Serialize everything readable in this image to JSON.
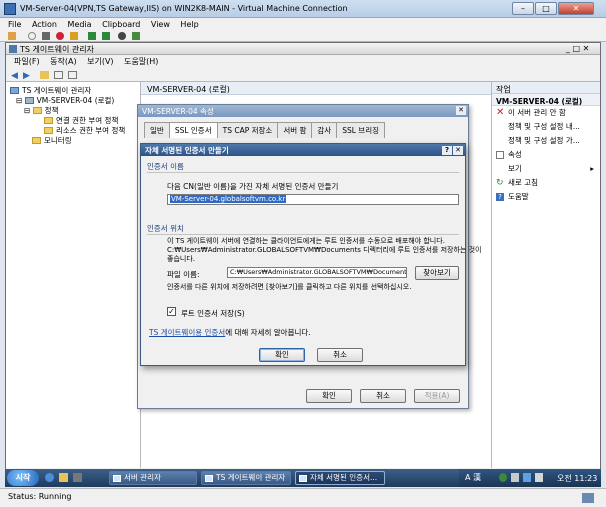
{
  "vm_window": {
    "title": "VM-Server-04(VPN,TS Gateway,IIS) on WIN2K8-MAIN - Virtual Machine Connection",
    "menu": [
      "File",
      "Action",
      "Media",
      "Clipboard",
      "View",
      "Help"
    ],
    "status": "Status: Running"
  },
  "guest": {
    "app_title": "TS 게이트웨이 관리자",
    "menu": [
      "파일(F)",
      "동작(A)",
      "보기(V)",
      "도움말(H)"
    ],
    "tree": {
      "root": "TS 게이트웨이 관리자",
      "server": "VM-SERVER-04 (로컬)",
      "policy": "정책",
      "cap": "연결 권한 부여 정책",
      "rap": "리소스 권한 부여 정책",
      "monitor": "모니터링"
    },
    "center_title": "VM-SERVER-04 (로컬)",
    "actions": {
      "header": "작업",
      "subheader": "VM-SERVER-04 (로컬)",
      "items": [
        "이 서버 관리 안 함",
        "정책 및 구성 설정 내...",
        "정책 및 구성 설정 가...",
        "속성",
        "보기",
        "새로 고침",
        "도움말"
      ]
    }
  },
  "props_dialog": {
    "title": "VM-SERVER-04 속성",
    "tabs": [
      "일반",
      "SSL 인증서",
      "TS CAP 저장소",
      "서버 팜",
      "감사",
      "SSL 브리징"
    ],
    "ok": "확인",
    "cancel": "취소",
    "apply": "적용(A)"
  },
  "cert_dialog": {
    "title": "자체 서명된 인증서 만들기",
    "cn_section": "인증서 이름",
    "cn_label": "다음 CN(일반 이름)을 가진 자체 서명된 인증서 만들기",
    "cn_value": "VM-Server-04.globalsoftvm.co.kr",
    "loc_section": "인증서 위치",
    "loc_desc1": "이 TS 게이트웨이 서버에 연결하는 클라이언트에게는 루트 인증서를 수동으로 배포해야 합니다.",
    "loc_desc2": "C:₩Users₩Administrator.GLOBALSOFTVM₩Documents 디렉터리에 루트 인증서를 저장하는 것이",
    "loc_desc3": "좋습니다.",
    "file_label": "파일 이름:",
    "file_value": "C:₩Users₩Administrator.GLOBALSOFTVM₩Documents₩VM-",
    "browse": "찾아보기",
    "save_hint": "인증서를 다른 위치에 저장하려면 [찾아보기]를 클릭하고 다른 위치를 선택하십시오.",
    "store_check": "루트 인증서 저장(S)",
    "link_text": "TS 게이트웨이용 인증서",
    "link_suffix": "에 대해 자세히 알아봅니다.",
    "ok": "확인",
    "cancel": "취소"
  },
  "taskbar": {
    "start": "시작",
    "tasks": [
      "서버 관리자",
      "TS 게이트웨이 관리자",
      "자체 서명된 인증서..."
    ],
    "lang": "A 漢",
    "clock": "오전 11:23"
  }
}
